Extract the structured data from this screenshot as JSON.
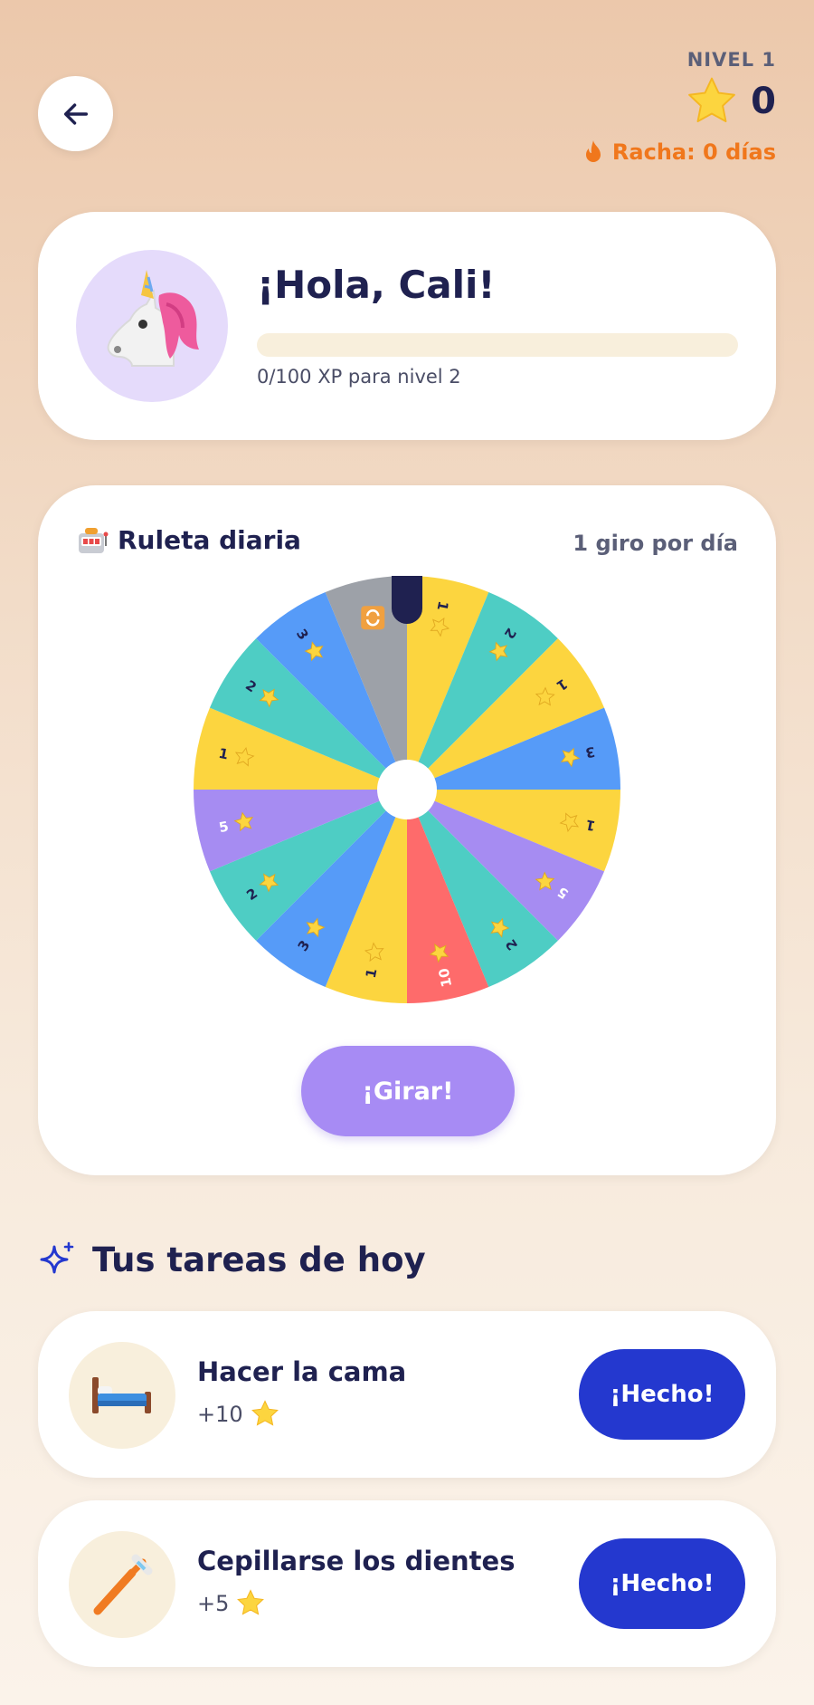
{
  "header": {
    "level_label": "NIVEL 1",
    "stars": "0",
    "streak": "Racha: 0 días"
  },
  "profile": {
    "greeting": "¡Hola, Cali!",
    "xp_text": "0/100 XP para nivel 2",
    "xp_progress": 0,
    "avatar": "unicorn-avatar"
  },
  "wheel": {
    "title": "Ruleta diaria",
    "subtitle": "1 giro por día",
    "spin_label": "¡Girar!",
    "segments": [
      {
        "label": "1",
        "color": "#fcd53f"
      },
      {
        "label": "2",
        "color": "#4ecdc4"
      },
      {
        "label": "1",
        "color": "#fcd53f"
      },
      {
        "label": "3",
        "color": "#569bf8"
      },
      {
        "label": "1",
        "color": "#fcd53f"
      },
      {
        "label": "5",
        "color": "#a68cf2"
      },
      {
        "label": "2",
        "color": "#4ecdc4"
      },
      {
        "label": "10",
        "color": "#fe6b6b"
      },
      {
        "label": "1",
        "color": "#fcd53f"
      },
      {
        "label": "3",
        "color": "#569bf8"
      },
      {
        "label": "2",
        "color": "#4ecdc4"
      },
      {
        "label": "5",
        "color": "#a68cf2"
      },
      {
        "label": "1",
        "color": "#fcd53f"
      },
      {
        "label": "2",
        "color": "#4ecdc4"
      },
      {
        "label": "3",
        "color": "#569bf8"
      },
      {
        "label": "",
        "color": "#9da1a8",
        "icon": "repeat-icon"
      }
    ]
  },
  "tasks": {
    "header": "Tus tareas de hoy",
    "items": [
      {
        "name": "Hacer la cama",
        "reward": "+10",
        "icon": "bed-icon",
        "button": "¡Hecho!"
      },
      {
        "name": "Cepillarse los dientes",
        "reward": "+5",
        "icon": "toothbrush-icon",
        "button": "¡Hecho!"
      }
    ]
  },
  "colors": {
    "accent": "#2438cf",
    "spin": "#a78bf4",
    "streak": "#f0771c",
    "text": "#1f2150"
  }
}
